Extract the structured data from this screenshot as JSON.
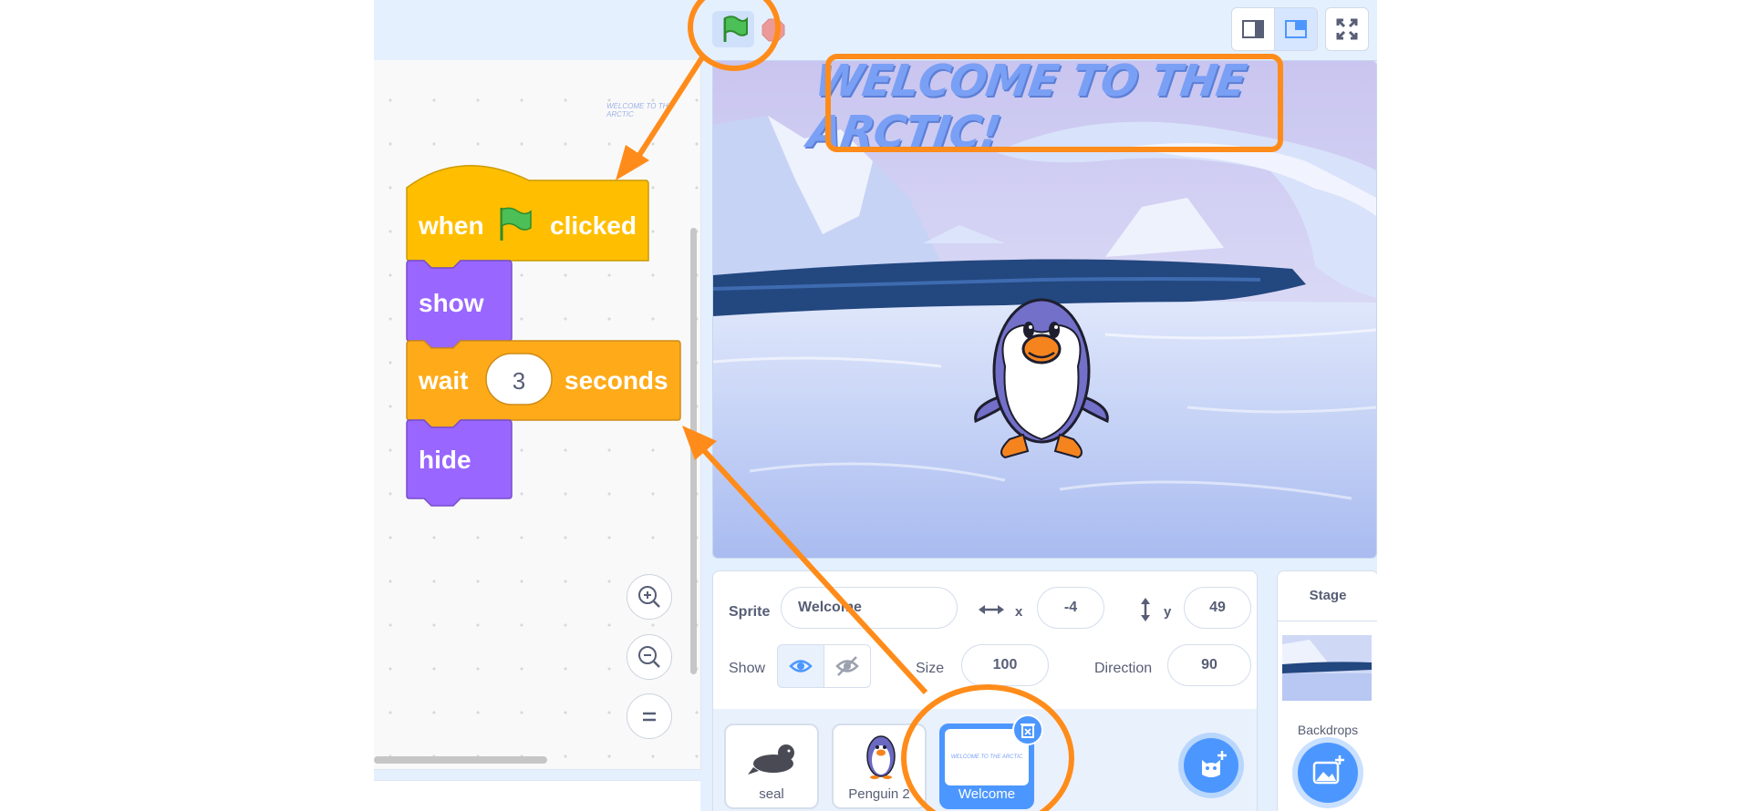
{
  "toolbar": {
    "green_flag_icon": "green-flag-icon",
    "stop_icon": "stop-icon",
    "layout_small_icon": "small-stage-icon",
    "layout_normal_icon": "normal-stage-icon",
    "fullscreen_icon": "fullscreen-icon"
  },
  "stage": {
    "title_text": "WELCOME TO THE ARCTIC!",
    "watermark_text": "WELCOME TO THE ARCTIC"
  },
  "blocks": [
    {
      "type": "event",
      "parts": [
        "when",
        "clicked"
      ],
      "color": "#ffbf00"
    },
    {
      "type": "looks",
      "label": "show",
      "color": "#9966ff"
    },
    {
      "type": "control",
      "label_before": "wait",
      "input_value": "3",
      "label_after": "seconds",
      "color": "#ffab19"
    },
    {
      "type": "looks",
      "label": "hide",
      "color": "#9966ff"
    }
  ],
  "sprite_info": {
    "sprite_label": "Sprite",
    "sprite_name": "Welcome",
    "x_label": "x",
    "x_value": "-4",
    "y_label": "y",
    "y_value": "49",
    "show_label": "Show",
    "size_label": "Size",
    "size_value": "100",
    "direction_label": "Direction",
    "direction_value": "90"
  },
  "sprites": [
    {
      "name": "seal"
    },
    {
      "name": "Penguin 2"
    },
    {
      "name": "Welcome",
      "selected": true
    }
  ],
  "stage_panel": {
    "title": "Stage",
    "backdrops_label": "Backdrops"
  },
  "colors": {
    "annotation": "#ff8c1a",
    "accent": "#4c97ff",
    "looks": "#9966ff",
    "events": "#ffbf00",
    "control": "#ffab19"
  }
}
